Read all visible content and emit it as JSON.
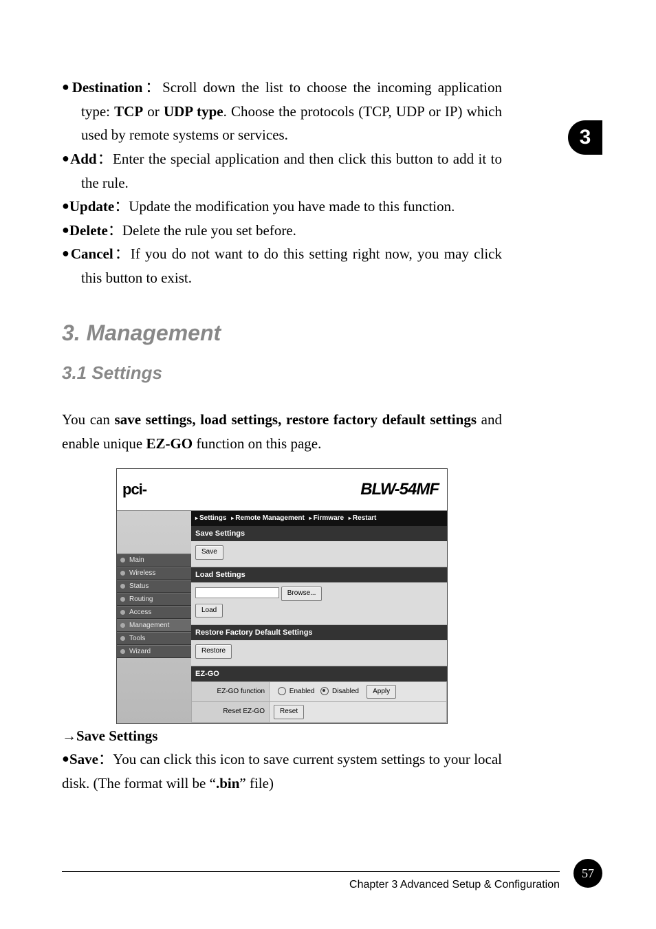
{
  "chapter_tab": "3",
  "page_number": "57",
  "footer": "Chapter 3 Advanced Setup & Configuration",
  "bullets": {
    "destination": {
      "term": "Destination",
      "text1": "：Scroll down the list to choose the incoming application type: ",
      "tcp": "TCP",
      "text2": " or ",
      "udp": "UDP type",
      "text3": ". Choose the protocols (TCP, UDP or IP) which used by remote systems or services."
    },
    "add": {
      "term": "Add",
      "text": "：Enter the special application and then click this button to add it to the rule."
    },
    "update": {
      "term": "Update",
      "text": "：Update the modification you have made to this function."
    },
    "delete": {
      "term": "Delete",
      "text": "：Delete the rule you set before."
    },
    "cancel": {
      "term": "Cancel",
      "text": "：If you do not want to do this setting right now, you may click this button to exist."
    }
  },
  "headings": {
    "management": "3. Management",
    "settings": "3.1 Settings"
  },
  "intro": {
    "pre": "You can ",
    "bold": "save settings, load settings, restore factory default settings",
    "mid": " and enable unique ",
    "ezgo": "EZ-GO",
    "post": " function on this page."
  },
  "screenshot": {
    "logo": "pci-",
    "brand": "BLW-54MF",
    "breadcrumbs": [
      "Settings",
      "Remote Management",
      "Firmware",
      "Restart"
    ],
    "nav": [
      "Main",
      "Wireless",
      "Status",
      "Routing",
      "Access",
      "Management",
      "Tools",
      "Wizard"
    ],
    "nav_active_index": 5,
    "sections": {
      "save": {
        "title": "Save Settings",
        "btn": "Save"
      },
      "load": {
        "title": "Load Settings",
        "browse": "Browse...",
        "btn": "Load"
      },
      "restore": {
        "title": "Restore Factory Default Settings",
        "btn": "Restore"
      },
      "ezgo": {
        "title": "EZ-GO",
        "row1_label": "EZ-GO function",
        "row1_opt1": "Enabled",
        "row1_opt2": "Disabled",
        "row1_btn": "Apply",
        "row2_label": "Reset EZ-GO",
        "row2_btn": "Reset"
      }
    }
  },
  "save_section": {
    "arrow_heading": "Save Settings",
    "term": "Save",
    "text1": "：You can click this icon to save current system settings to your local disk. (The format will be ",
    "quote_open": "“",
    "binfile": ".bin",
    "quote_close": "”",
    "text2": " file)"
  }
}
